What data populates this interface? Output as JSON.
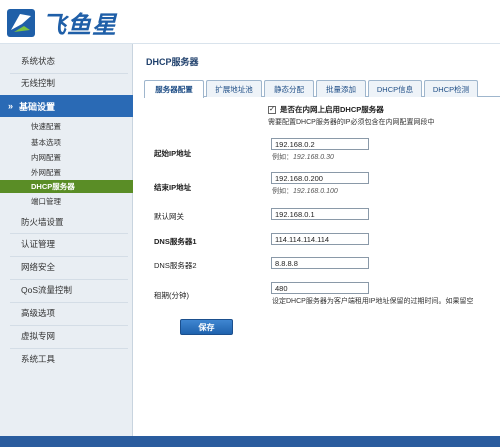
{
  "brand": {
    "name": "飞鱼星"
  },
  "sidebar": {
    "top_items": [
      {
        "label": "系统状态"
      },
      {
        "label": "无线控制"
      }
    ],
    "active_group": {
      "label": "基础设置"
    },
    "sub_items": [
      {
        "label": "快速配置"
      },
      {
        "label": "基本选项"
      },
      {
        "label": "内网配置"
      },
      {
        "label": "外网配置"
      },
      {
        "label": "DHCP服务器"
      },
      {
        "label": "端口管理"
      }
    ],
    "bottom_items": [
      {
        "label": "防火墙设置"
      },
      {
        "label": "认证管理"
      },
      {
        "label": "网络安全"
      },
      {
        "label": "QoS流量控制"
      },
      {
        "label": "高级选项"
      },
      {
        "label": "虚拟专网"
      },
      {
        "label": "系统工具"
      }
    ]
  },
  "main": {
    "title": "DHCP服务器",
    "tabs": [
      {
        "label": "服务器配置"
      },
      {
        "label": "扩展地址池"
      },
      {
        "label": "静态分配"
      },
      {
        "label": "批量添加"
      },
      {
        "label": "DHCP信息"
      },
      {
        "label": "DHCP检测"
      }
    ],
    "enable_checkbox": {
      "checked": true,
      "label": "是否在内网上启用DHCP服务器"
    },
    "enable_note": "需要配置DHCP服务器的IP必须包含在内网配置网段中",
    "fields": {
      "start_ip": {
        "label": "起始IP地址",
        "value": "192.168.0.2",
        "example": "例如：",
        "example_value": "192.168.0.30"
      },
      "end_ip": {
        "label": "结束IP地址",
        "value": "192.168.0.200",
        "example": "例如：",
        "example_value": "192.168.0.100"
      },
      "gateway": {
        "label": "默认网关",
        "value": "192.168.0.1"
      },
      "dns1": {
        "label": "DNS服务器1",
        "value": "114.114.114.114"
      },
      "dns2": {
        "label": "DNS服务器2",
        "value": "8.8.8.8"
      },
      "lease": {
        "label": "租期(分钟)",
        "value": "480",
        "note": "设定DHCP服务器为客户端租用IP地址保留的过期时间。如果留空"
      }
    },
    "save_label": "保存"
  },
  "colors": {
    "brand_blue": "#1f5fa8",
    "nav_active": "#2a6ab5",
    "sub_active": "#5a8d26",
    "sidebar_bg": "#e9eef3"
  }
}
